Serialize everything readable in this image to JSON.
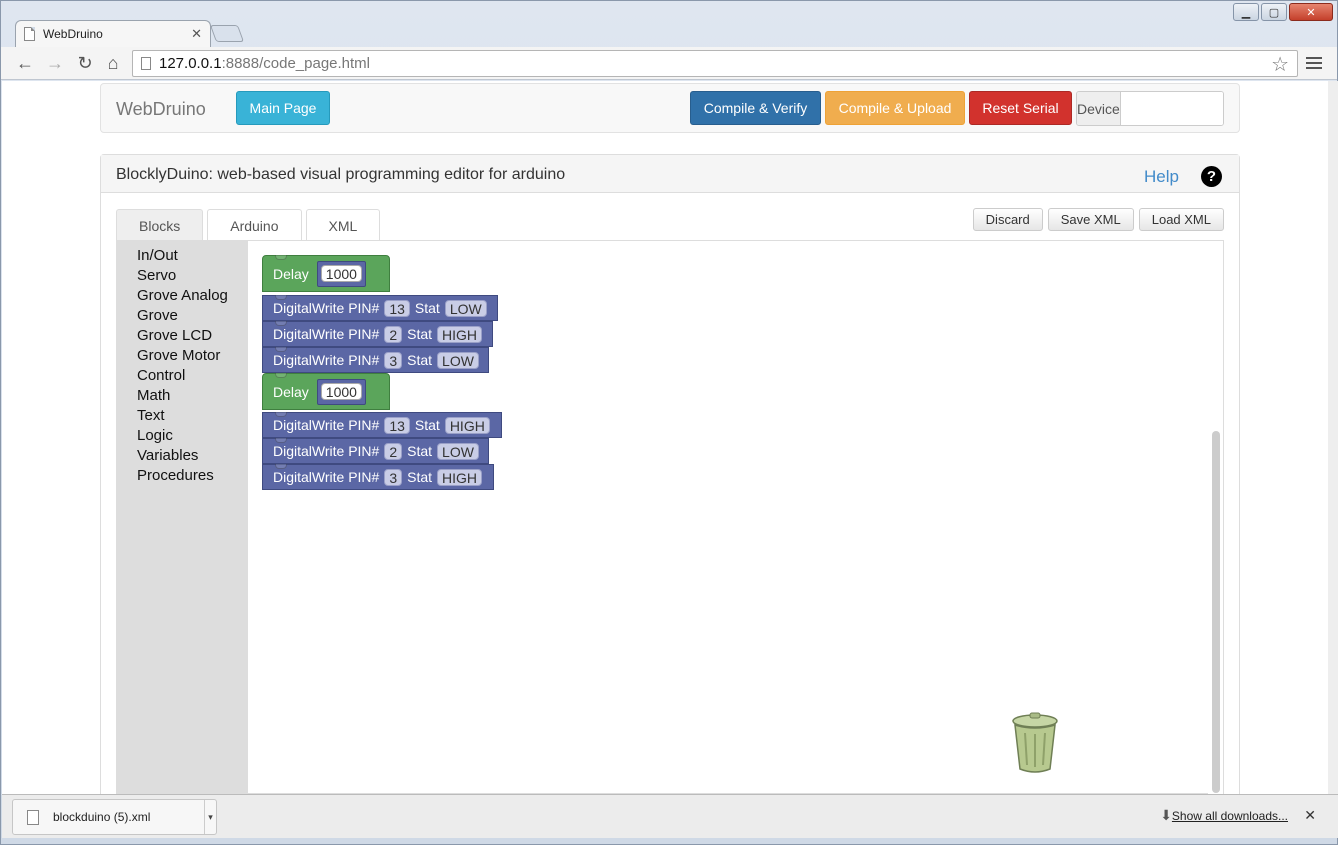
{
  "browser": {
    "tab_title": "WebDruino",
    "url_host": "127.0.0.1",
    "url_rest": ":8888/code_page.html",
    "icons": [
      "back-arrow-icon",
      "forward-arrow-icon",
      "reload-icon",
      "home-icon",
      "star-icon",
      "menu-icon"
    ]
  },
  "navbar": {
    "brand": "WebDruino",
    "main_page": "Main Page",
    "compile_verify": "Compile & Verify",
    "compile_upload": "Compile & Upload",
    "reset_serial": "Reset Serial",
    "device_label": "Device",
    "device_value": ""
  },
  "panel": {
    "title": "BlocklyDuino: web-based visual programming editor for arduino",
    "help": "Help",
    "tabs": [
      "Blocks",
      "Arduino",
      "XML"
    ],
    "active_tab": "Blocks",
    "actions": {
      "discard": "Discard",
      "save_xml": "Save XML",
      "load_xml": "Load XML"
    }
  },
  "toolbox": [
    "In/Out",
    "Servo",
    "Grove Analog",
    "Grove",
    "Grove LCD",
    "Grove Motor",
    "Control",
    "Math",
    "Text",
    "Logic",
    "Variables",
    "Procedures"
  ],
  "blocks": [
    {
      "type": "delay",
      "label": "Delay",
      "value": "1000"
    },
    {
      "type": "digitalwrite",
      "label": "DigitalWrite PIN#",
      "pin": "13",
      "stat_label": "Stat",
      "stat": "LOW"
    },
    {
      "type": "digitalwrite",
      "label": "DigitalWrite PIN#",
      "pin": "2",
      "stat_label": "Stat",
      "stat": "HIGH"
    },
    {
      "type": "digitalwrite",
      "label": "DigitalWrite PIN#",
      "pin": "3",
      "stat_label": "Stat",
      "stat": "LOW"
    },
    {
      "type": "delay",
      "label": "Delay",
      "value": "1000"
    },
    {
      "type": "digitalwrite",
      "label": "DigitalWrite PIN#",
      "pin": "13",
      "stat_label": "Stat",
      "stat": "HIGH"
    },
    {
      "type": "digitalwrite",
      "label": "DigitalWrite PIN#",
      "pin": "2",
      "stat_label": "Stat",
      "stat": "LOW"
    },
    {
      "type": "digitalwrite",
      "label": "DigitalWrite PIN#",
      "pin": "3",
      "stat_label": "Stat",
      "stat": "HIGH"
    }
  ],
  "downloads": {
    "file": "blockduino (5).xml",
    "show_all": "Show all downloads..."
  },
  "colors": {
    "delay_block": "#5ba55b",
    "digitalwrite_block": "#5b67a5",
    "btn_info": "#39b3d7",
    "btn_primary": "#3071a9",
    "btn_warning": "#f0ad4e",
    "btn_danger": "#d2322d"
  }
}
